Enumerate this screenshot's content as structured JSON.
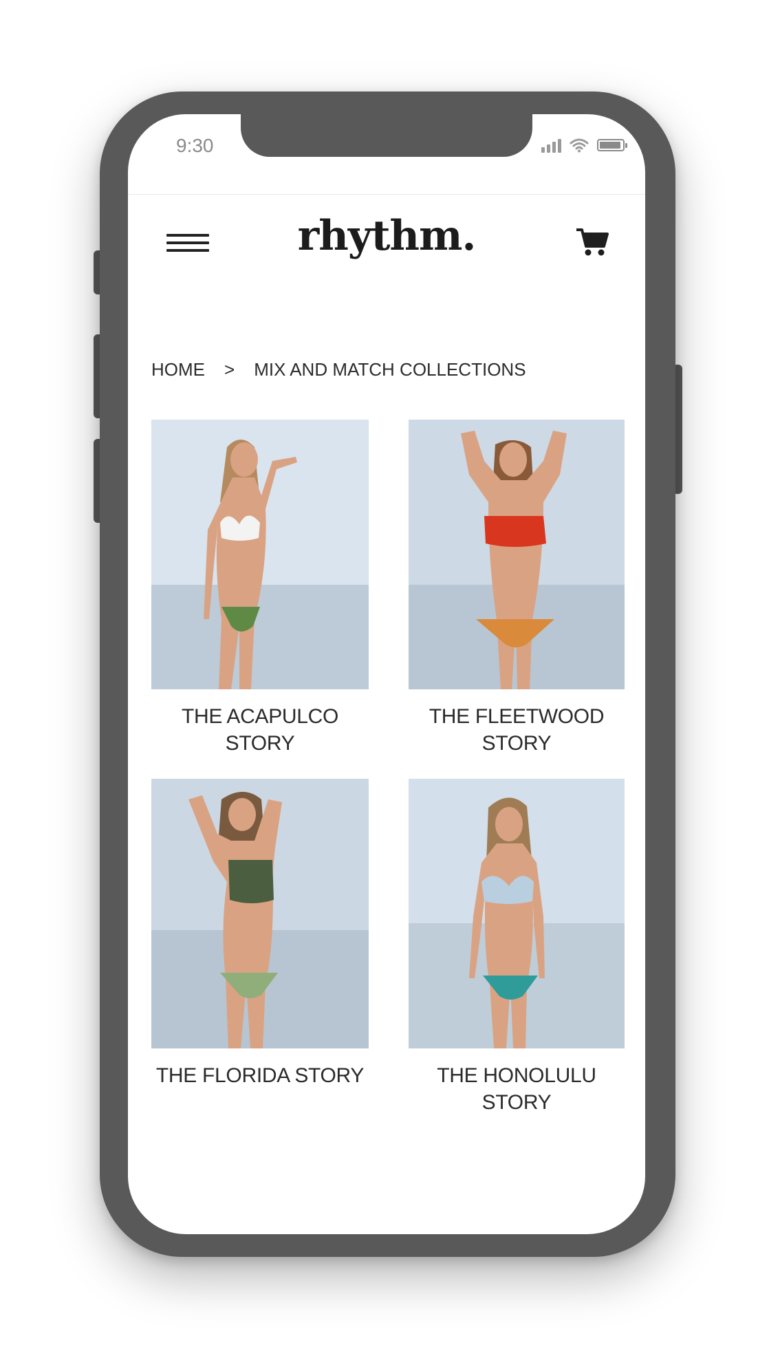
{
  "status_bar": {
    "time": "9:30",
    "battery_level": 0.95
  },
  "header": {
    "logo": "rhythm."
  },
  "breadcrumb": {
    "home": "HOME",
    "separator": ">",
    "current": "MIX AND MATCH COLLECTIONS"
  },
  "products": [
    {
      "name": "THE ACAPULCO STORY",
      "top_color": "#f3f3f3",
      "bottom_color": "#5f8a45"
    },
    {
      "name": "THE FLEETWOOD STORY",
      "top_color": "#d9361f",
      "bottom_color": "#d98a3a"
    },
    {
      "name": "THE FLORIDA STORY",
      "top_color": "#4b5e3f",
      "bottom_color": "#8fae7a"
    },
    {
      "name": "THE HONOLULU STORY",
      "top_color": "#b9cfe0",
      "bottom_color": "#2f9c9a"
    }
  ],
  "colors": {
    "frame": "#595959",
    "sky": "#d9e4ef",
    "sea": "#b8c9d6",
    "skin": "#d9a383"
  }
}
